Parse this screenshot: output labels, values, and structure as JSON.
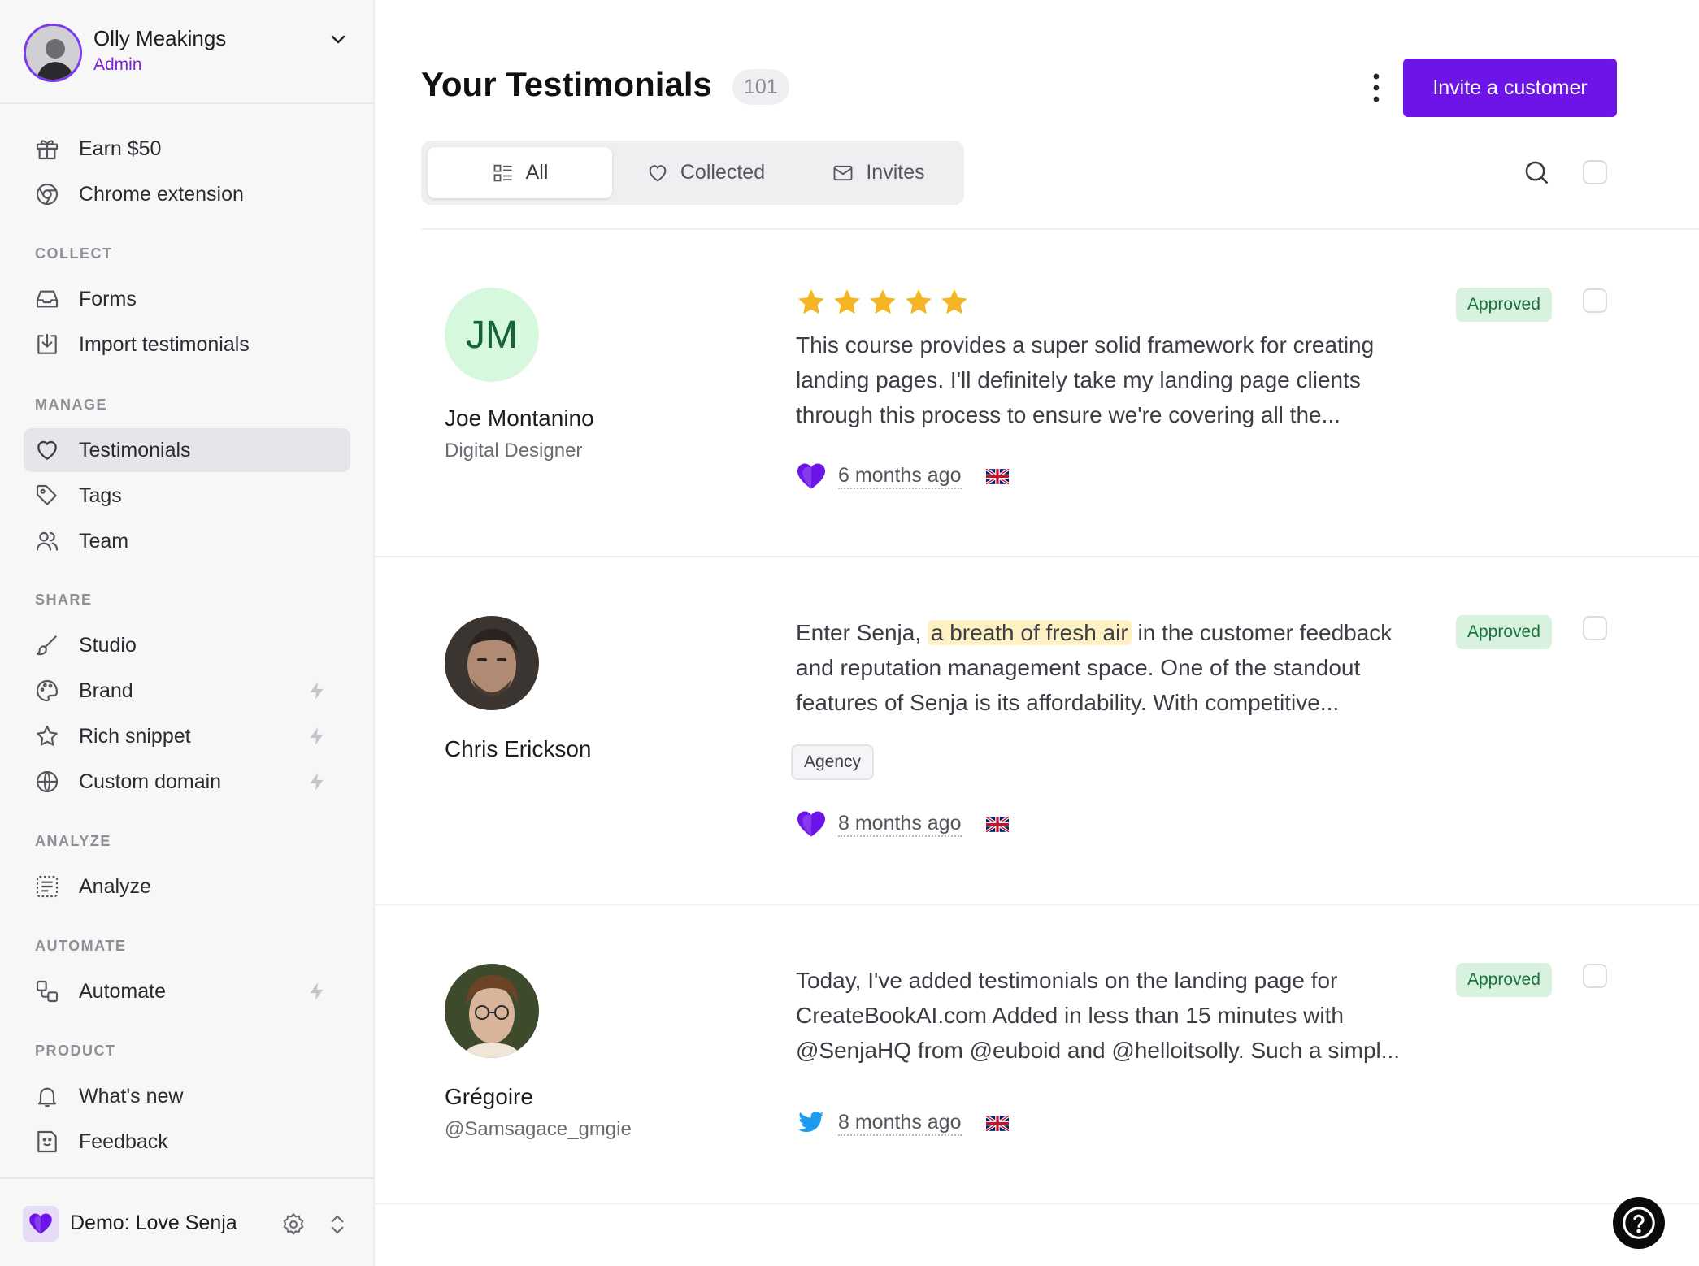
{
  "profile": {
    "name": "Olly Meakings",
    "role": "Admin"
  },
  "nav_top": [
    {
      "label": "Earn $50",
      "icon": "gift-icon"
    },
    {
      "label": "Chrome extension",
      "icon": "chrome-icon"
    }
  ],
  "sections": {
    "collect": "COLLECT",
    "manage": "MANAGE",
    "share": "SHARE",
    "analyze": "ANALYZE",
    "automate": "AUTOMATE",
    "product": "PRODUCT"
  },
  "nav_collect": [
    {
      "label": "Forms",
      "icon": "inbox-icon"
    },
    {
      "label": "Import testimonials",
      "icon": "import-icon"
    }
  ],
  "nav_manage": [
    {
      "label": "Testimonials",
      "icon": "heart-icon",
      "active": true
    },
    {
      "label": "Tags",
      "icon": "tag-icon"
    },
    {
      "label": "Team",
      "icon": "team-icon"
    }
  ],
  "nav_share": [
    {
      "label": "Studio",
      "icon": "brush-icon"
    },
    {
      "label": "Brand",
      "icon": "palette-icon",
      "premium": true
    },
    {
      "label": "Rich snippet",
      "icon": "star-icon",
      "premium": true
    },
    {
      "label": "Custom domain",
      "icon": "globe-icon",
      "premium": true
    }
  ],
  "nav_analyze": [
    {
      "label": "Analyze",
      "icon": "analyze-icon"
    }
  ],
  "nav_automate": [
    {
      "label": "Automate",
      "icon": "automate-icon",
      "premium": true
    }
  ],
  "nav_product": [
    {
      "label": "What's new",
      "icon": "bell-icon"
    },
    {
      "label": "Feedback",
      "icon": "feedback-icon"
    }
  ],
  "project": {
    "name": "Demo: Love Senja"
  },
  "header": {
    "title": "Your Testimonials",
    "count": "101",
    "invite_label": "Invite a customer"
  },
  "tabs": [
    {
      "label": "All",
      "icon": "list-icon",
      "active": true
    },
    {
      "label": "Collected",
      "icon": "heart-icon"
    },
    {
      "label": "Invites",
      "icon": "mail-icon"
    }
  ],
  "testimonials": [
    {
      "initials": "JM",
      "name": "Joe Montanino",
      "subtitle": "Digital Designer",
      "rating": 5,
      "text": "This course provides a super solid framework for creating landing pages. I'll definitely take my landing page clients through this process to ensure we're covering all the...",
      "status": "Approved",
      "source": "senja-heart",
      "time": "6 months ago",
      "flag": "uk-flag"
    },
    {
      "name": "Chris Erickson",
      "text_before": "Enter Senja, ",
      "text_highlight": "a breath of fresh air",
      "text_after": " in the customer feedback and reputation management space. One of the standout features of Senja is its affordability. With competitive...",
      "tag": "Agency",
      "status": "Approved",
      "source": "senja-heart",
      "time": "8 months ago",
      "flag": "uk-flag"
    },
    {
      "name": "Grégoire",
      "subtitle": "@Samsagace_gmgie",
      "text": "Today, I've added testimonials on the landing page for CreateBookAI.com Added in less than 15 minutes with @SenjaHQ from @euboid and @helloitsolly. Such a simpl...",
      "status": "Approved",
      "source": "twitter",
      "time": "8 months ago",
      "flag": "uk-flag"
    }
  ],
  "colors": {
    "accent": "#6d14e8",
    "approved_bg": "#d8f2df",
    "approved_text": "#17733a",
    "star": "#f7b423",
    "highlight": "#fdf1c4"
  }
}
